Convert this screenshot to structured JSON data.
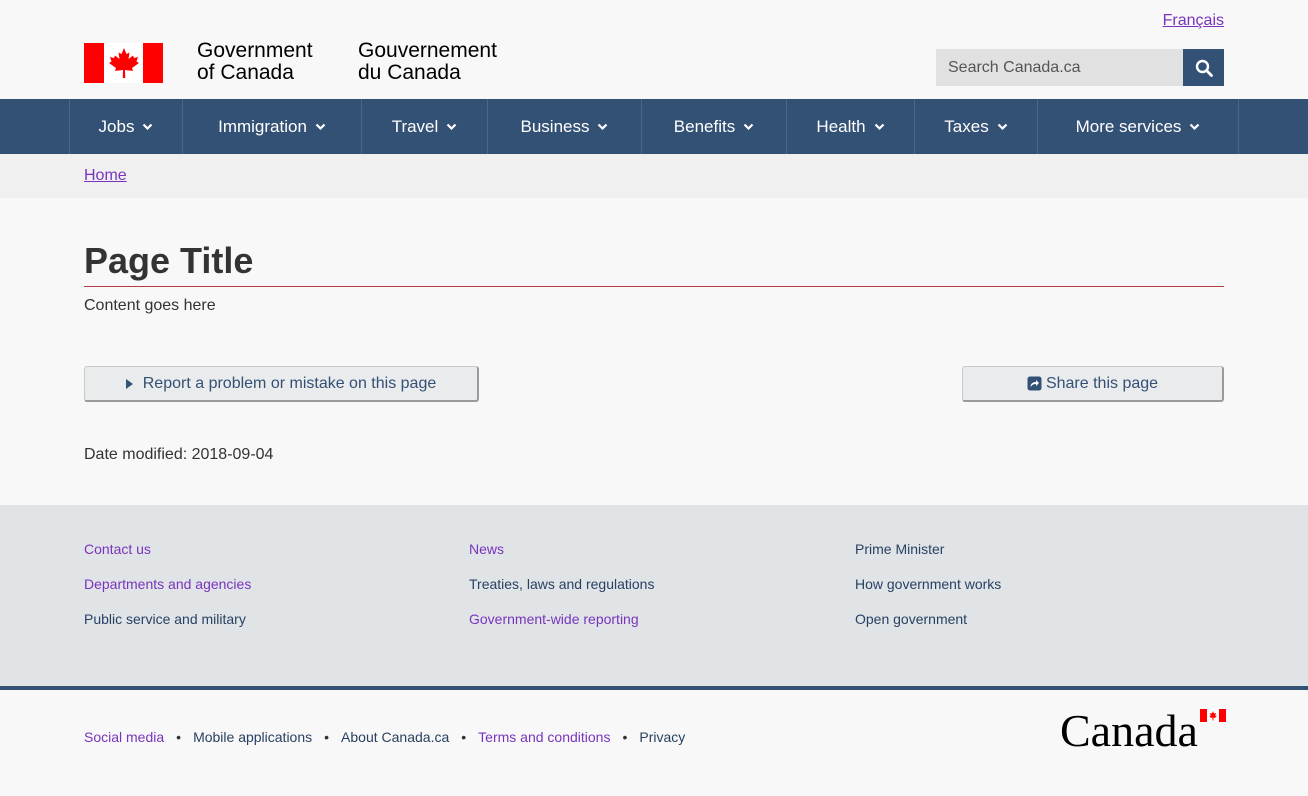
{
  "header": {
    "language_link": "Français",
    "signature_en_line1": "Government",
    "signature_en_line2": "of Canada",
    "signature_fr_line1": "Gouvernement",
    "signature_fr_line2": "du Canada",
    "search_placeholder": "Search Canada.ca"
  },
  "nav": {
    "items": [
      {
        "label": "Jobs"
      },
      {
        "label": "Immigration"
      },
      {
        "label": "Travel"
      },
      {
        "label": "Business"
      },
      {
        "label": "Benefits"
      },
      {
        "label": "Health"
      },
      {
        "label": "Taxes"
      },
      {
        "label": "More services"
      }
    ]
  },
  "breadcrumb": {
    "home": "Home"
  },
  "main": {
    "title": "Page Title",
    "content": "Content goes here",
    "report_button": "Report a problem or mistake on this page",
    "share_button": "Share this page",
    "date_modified": "Date modified: 2018-09-04"
  },
  "footer": {
    "col1": [
      "Contact us",
      "Departments and agencies",
      "Public service and military"
    ],
    "col2": [
      "News",
      "Treaties, laws and regulations",
      "Government-wide reporting"
    ],
    "col3": [
      "Prime Minister",
      "How government works",
      "Open government"
    ],
    "sub_links": [
      "Social media",
      "Mobile applications",
      "About Canada.ca",
      "Terms and conditions",
      "Privacy"
    ],
    "wordmark": "Canada"
  },
  "colors": {
    "nav_bg": "#335075",
    "visited_link": "#7834bc",
    "link": "#284162",
    "title_rule": "#af3c43",
    "flag_red": "#ff0000"
  }
}
